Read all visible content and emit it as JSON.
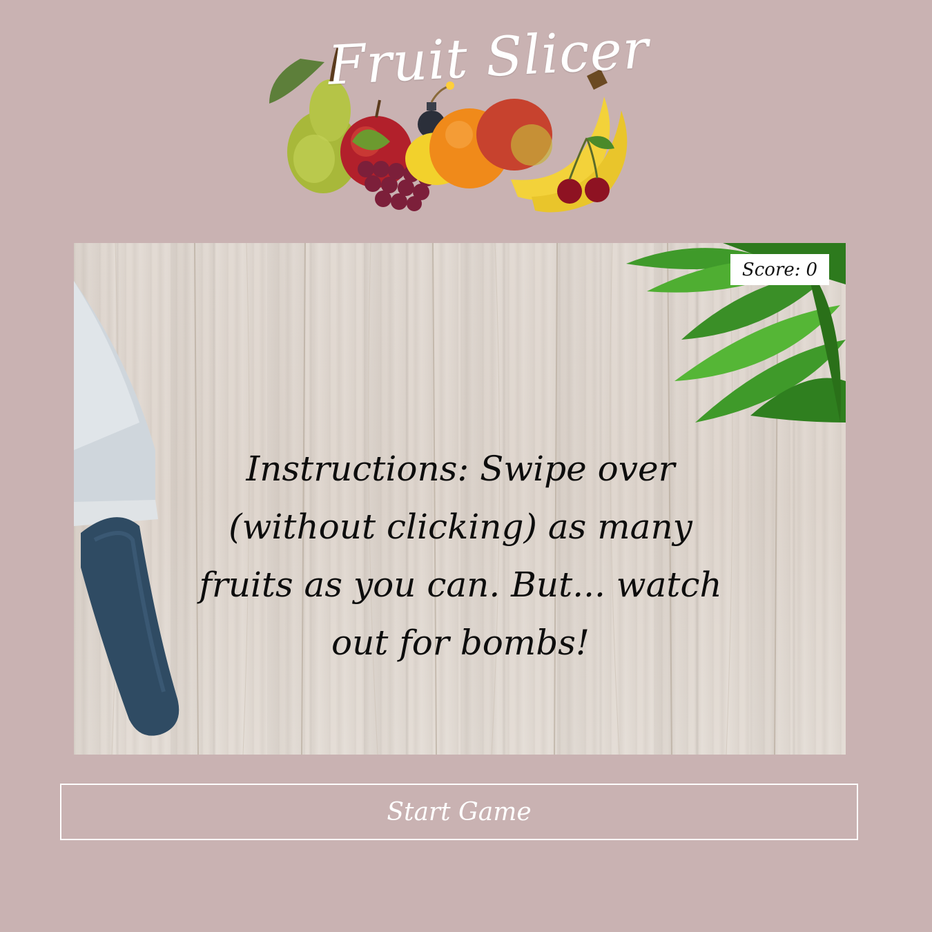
{
  "header": {
    "logo_title": "Fruit Slicer",
    "logo_image": "fruit-assortment-with-bomb"
  },
  "game": {
    "background_image": "wooden-cutting-board-with-knife-and-greens",
    "score_label": "Score:",
    "score_value": "0",
    "instructions": "Instructions: Swipe over (without clicking) as many fruits as you can. But... watch out for bombs!"
  },
  "controls": {
    "start_label": "Start Game"
  },
  "colors": {
    "page_background": "#c9b2b2",
    "button_border": "#ffffff",
    "knife_handle": "#2f4b63"
  }
}
